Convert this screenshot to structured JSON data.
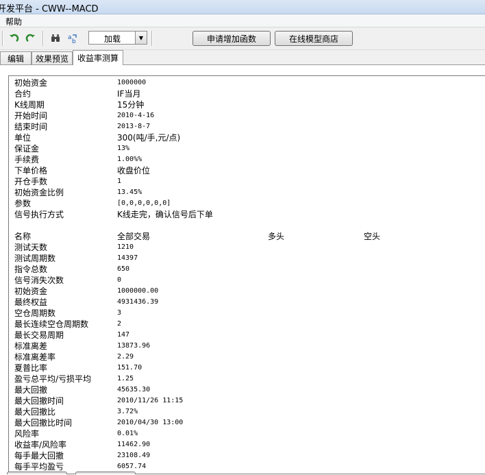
{
  "window": {
    "title": "开发平台 - CWW--MACD"
  },
  "menu": {
    "help": "帮助"
  },
  "toolbar": {
    "icons": [
      "undo-icon",
      "redo-icon",
      "binoculars-icon",
      "replace-icon"
    ],
    "combo_value": "加载",
    "apply_function_button": "申请增加函数",
    "model_store_button": "在线模型商店"
  },
  "tabs": [
    {
      "label": "编辑"
    },
    {
      "label": "效果预览"
    },
    {
      "label": "收益率测算",
      "active": true
    }
  ],
  "params": [
    {
      "label": "初始资金",
      "value": "1000000"
    },
    {
      "label": "合约",
      "value": "IF当月"
    },
    {
      "label": "K线周期",
      "value": "15分钟"
    },
    {
      "label": "开始时间",
      "value": "2010-4-16"
    },
    {
      "label": "结束时间",
      "value": "2013-8-7"
    },
    {
      "label": "单位",
      "value": "300(吨/手,元/点)"
    },
    {
      "label": "保证金",
      "value": "13%"
    },
    {
      "label": "手续费",
      "value": "1.00%%"
    },
    {
      "label": "下单价格",
      "value": "收盘价位"
    },
    {
      "label": "开仓手数",
      "value": "1"
    },
    {
      "label": "初始资金比例",
      "value": "13.45%"
    },
    {
      "label": "参数",
      "value": "[0,0,0,0,0,0]"
    },
    {
      "label": "信号执行方式",
      "value": "K线走完，确认信号后下单"
    }
  ],
  "stats_header": {
    "name": "名称",
    "all": "全部交易",
    "long": "多头",
    "short": "空头"
  },
  "stats": [
    {
      "label": "测试天数",
      "value": "1210"
    },
    {
      "label": "测试周期数",
      "value": "14397"
    },
    {
      "label": "指令总数",
      "value": "650"
    },
    {
      "label": "信号消失次数",
      "value": "0"
    },
    {
      "label": "初始资金",
      "value": "1000000.00"
    },
    {
      "label": "最终权益",
      "value": "4931436.39"
    },
    {
      "label": "空仓周期数",
      "value": "3"
    },
    {
      "label": "最长连续空仓周期数",
      "value": "2"
    },
    {
      "label": "最长交易周期",
      "value": "147"
    },
    {
      "label": "标准离差",
      "value": "13873.96"
    },
    {
      "label": "标准离差率",
      "value": "2.29"
    },
    {
      "label": "夏普比率",
      "value": "151.70"
    },
    {
      "label": "盈亏总平均/亏损平均",
      "value": "1.25"
    },
    {
      "label": "最大回撤",
      "value": "45635.30"
    },
    {
      "label": "最大回撤时间",
      "value": "2010/11/26 11:15"
    },
    {
      "label": "最大回撤比",
      "value": "3.72%"
    },
    {
      "label": "最大回撤比时间",
      "value": "2010/04/30 13:00"
    },
    {
      "label": "风险率",
      "value": "0.01%"
    },
    {
      "label": "收益率/风险率",
      "value": "11462.90"
    },
    {
      "label": "每手最大回撤",
      "value": "23108.49"
    },
    {
      "label": "每手平均盈亏",
      "value": "6057.74"
    }
  ]
}
